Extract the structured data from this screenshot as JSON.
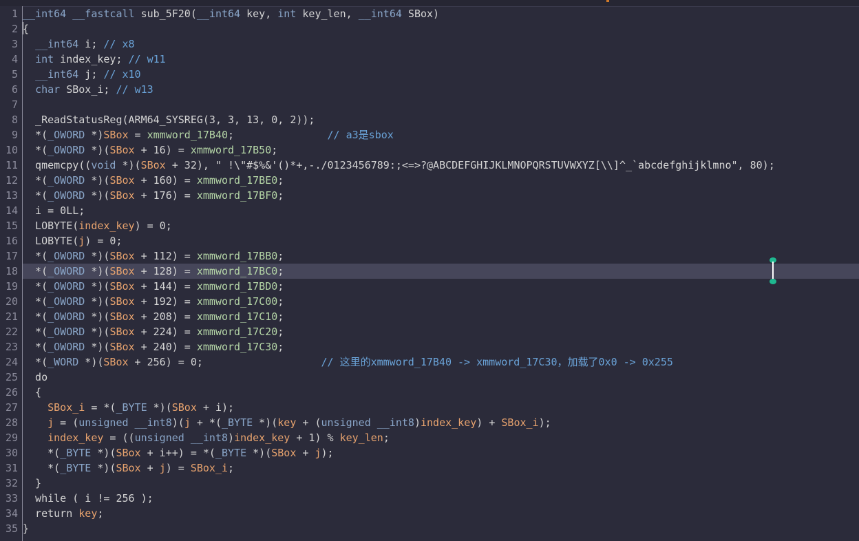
{
  "editor": {
    "function_name": "sub_5F20",
    "highlighted_line": 18,
    "lines": [
      {
        "n": "1",
        "tokens": [
          [
            "type",
            "__int64"
          ],
          [
            "plain",
            " "
          ],
          [
            "type",
            "__fastcall"
          ],
          [
            "plain",
            " sub_5F20("
          ],
          [
            "type",
            "__int64"
          ],
          [
            "plain",
            " key, "
          ],
          [
            "type",
            "int"
          ],
          [
            "plain",
            " key_len, "
          ],
          [
            "type",
            "__int64"
          ],
          [
            "plain",
            " SBox)"
          ]
        ]
      },
      {
        "n": "2",
        "tokens": [
          [
            "plain",
            "{"
          ]
        ]
      },
      {
        "n": "3",
        "tokens": [
          [
            "plain",
            "  "
          ],
          [
            "type",
            "__int64"
          ],
          [
            "plain",
            " i; "
          ],
          [
            "cmt",
            "// x8"
          ]
        ]
      },
      {
        "n": "4",
        "tokens": [
          [
            "plain",
            "  "
          ],
          [
            "type",
            "int"
          ],
          [
            "plain",
            " index_key; "
          ],
          [
            "cmt",
            "// w11"
          ]
        ]
      },
      {
        "n": "5",
        "tokens": [
          [
            "plain",
            "  "
          ],
          [
            "type",
            "__int64"
          ],
          [
            "plain",
            " j; "
          ],
          [
            "cmt",
            "// x10"
          ]
        ]
      },
      {
        "n": "6",
        "tokens": [
          [
            "plain",
            "  "
          ],
          [
            "type",
            "char"
          ],
          [
            "plain",
            " SBox_i; "
          ],
          [
            "cmt",
            "// w13"
          ]
        ]
      },
      {
        "n": "7",
        "tokens": [
          [
            "plain",
            ""
          ]
        ]
      },
      {
        "n": "8",
        "tokens": [
          [
            "plain",
            "  _ReadStatusReg(ARM64_SYSREG(3, 3, 13, 0, 2));"
          ]
        ]
      },
      {
        "n": "9",
        "tokens": [
          [
            "plain",
            "  *("
          ],
          [
            "type",
            "_OWORD"
          ],
          [
            "plain",
            " *)"
          ],
          [
            "var",
            "SBox"
          ],
          [
            "plain",
            " = "
          ],
          [
            "gbl",
            "xmmword_17B40"
          ],
          [
            "plain",
            ";               "
          ],
          [
            "cmt",
            "// a3是sbox"
          ]
        ]
      },
      {
        "n": "10",
        "tokens": [
          [
            "plain",
            "  *("
          ],
          [
            "type",
            "_OWORD"
          ],
          [
            "plain",
            " *)("
          ],
          [
            "var",
            "SBox"
          ],
          [
            "plain",
            " + 16) = "
          ],
          [
            "gbl",
            "xmmword_17B50"
          ],
          [
            "plain",
            ";"
          ]
        ]
      },
      {
        "n": "11",
        "tokens": [
          [
            "plain",
            "  qmemcpy(("
          ],
          [
            "type",
            "void"
          ],
          [
            "plain",
            " *)("
          ],
          [
            "var",
            "SBox"
          ],
          [
            "plain",
            " + 32), \" !\\\"#$%&'()*+,-./0123456789:;<=>?@ABCDEFGHIJKLMNOPQRSTUVWXYZ[\\\\]^_`abcdefghijklmno\", 80);"
          ]
        ]
      },
      {
        "n": "12",
        "tokens": [
          [
            "plain",
            "  *("
          ],
          [
            "type",
            "_OWORD"
          ],
          [
            "plain",
            " *)("
          ],
          [
            "var",
            "SBox"
          ],
          [
            "plain",
            " + 160) = "
          ],
          [
            "gbl",
            "xmmword_17BE0"
          ],
          [
            "plain",
            ";"
          ]
        ]
      },
      {
        "n": "13",
        "tokens": [
          [
            "plain",
            "  *("
          ],
          [
            "type",
            "_OWORD"
          ],
          [
            "plain",
            " *)("
          ],
          [
            "var",
            "SBox"
          ],
          [
            "plain",
            " + 176) = "
          ],
          [
            "gbl",
            "xmmword_17BF0"
          ],
          [
            "plain",
            ";"
          ]
        ]
      },
      {
        "n": "14",
        "tokens": [
          [
            "plain",
            "  i = 0LL;"
          ]
        ]
      },
      {
        "n": "15",
        "tokens": [
          [
            "plain",
            "  LOBYTE("
          ],
          [
            "var",
            "index_key"
          ],
          [
            "plain",
            ") = 0;"
          ]
        ]
      },
      {
        "n": "16",
        "tokens": [
          [
            "plain",
            "  LOBYTE("
          ],
          [
            "var",
            "j"
          ],
          [
            "plain",
            ") = 0;"
          ]
        ]
      },
      {
        "n": "17",
        "tokens": [
          [
            "plain",
            "  *("
          ],
          [
            "type",
            "_OWORD"
          ],
          [
            "plain",
            " *)("
          ],
          [
            "var",
            "SBox"
          ],
          [
            "plain",
            " + 112) = "
          ],
          [
            "gbl",
            "xmmword_17BB0"
          ],
          [
            "plain",
            ";"
          ]
        ]
      },
      {
        "n": "18",
        "tokens": [
          [
            "plain",
            "  *("
          ],
          [
            "type",
            "_OWORD"
          ],
          [
            "plain",
            " *)("
          ],
          [
            "var",
            "SBox"
          ],
          [
            "plain",
            " + 128) = "
          ],
          [
            "gbl",
            "xmmword_17BC0"
          ],
          [
            "plain",
            ";"
          ]
        ]
      },
      {
        "n": "19",
        "tokens": [
          [
            "plain",
            "  *("
          ],
          [
            "type",
            "_OWORD"
          ],
          [
            "plain",
            " *)("
          ],
          [
            "var",
            "SBox"
          ],
          [
            "plain",
            " + 144) = "
          ],
          [
            "gbl",
            "xmmword_17BD0"
          ],
          [
            "plain",
            ";"
          ]
        ]
      },
      {
        "n": "20",
        "tokens": [
          [
            "plain",
            "  *("
          ],
          [
            "type",
            "_OWORD"
          ],
          [
            "plain",
            " *)("
          ],
          [
            "var",
            "SBox"
          ],
          [
            "plain",
            " + 192) = "
          ],
          [
            "gbl",
            "xmmword_17C00"
          ],
          [
            "plain",
            ";"
          ]
        ]
      },
      {
        "n": "21",
        "tokens": [
          [
            "plain",
            "  *("
          ],
          [
            "type",
            "_OWORD"
          ],
          [
            "plain",
            " *)("
          ],
          [
            "var",
            "SBox"
          ],
          [
            "plain",
            " + 208) = "
          ],
          [
            "gbl",
            "xmmword_17C10"
          ],
          [
            "plain",
            ";"
          ]
        ]
      },
      {
        "n": "22",
        "tokens": [
          [
            "plain",
            "  *("
          ],
          [
            "type",
            "_OWORD"
          ],
          [
            "plain",
            " *)("
          ],
          [
            "var",
            "SBox"
          ],
          [
            "plain",
            " + 224) = "
          ],
          [
            "gbl",
            "xmmword_17C20"
          ],
          [
            "plain",
            ";"
          ]
        ]
      },
      {
        "n": "23",
        "tokens": [
          [
            "plain",
            "  *("
          ],
          [
            "type",
            "_OWORD"
          ],
          [
            "plain",
            " *)("
          ],
          [
            "var",
            "SBox"
          ],
          [
            "plain",
            " + 240) = "
          ],
          [
            "gbl",
            "xmmword_17C30"
          ],
          [
            "plain",
            ";"
          ]
        ]
      },
      {
        "n": "24",
        "tokens": [
          [
            "plain",
            "  *("
          ],
          [
            "type",
            "_WORD"
          ],
          [
            "plain",
            " *)("
          ],
          [
            "var",
            "SBox"
          ],
          [
            "plain",
            " + 256) = 0;                   "
          ],
          [
            "cmt",
            "// 这里的xmmword_17B40 -> xmmword_17C30，加载了0x0 -> 0x255"
          ]
        ]
      },
      {
        "n": "25",
        "tokens": [
          [
            "plain",
            "  do"
          ]
        ]
      },
      {
        "n": "26",
        "tokens": [
          [
            "plain",
            "  {"
          ]
        ]
      },
      {
        "n": "27",
        "tokens": [
          [
            "plain",
            "    "
          ],
          [
            "var",
            "SBox_i"
          ],
          [
            "plain",
            " = *("
          ],
          [
            "type",
            "_BYTE"
          ],
          [
            "plain",
            " *)("
          ],
          [
            "var",
            "SBox"
          ],
          [
            "plain",
            " + i);"
          ]
        ]
      },
      {
        "n": "28",
        "tokens": [
          [
            "plain",
            "    "
          ],
          [
            "var",
            "j"
          ],
          [
            "plain",
            " = ("
          ],
          [
            "type",
            "unsigned __int8"
          ],
          [
            "plain",
            ")("
          ],
          [
            "var",
            "j"
          ],
          [
            "plain",
            " + *("
          ],
          [
            "type",
            "_BYTE"
          ],
          [
            "plain",
            " *)("
          ],
          [
            "var",
            "key"
          ],
          [
            "plain",
            " + ("
          ],
          [
            "type",
            "unsigned __int8"
          ],
          [
            "plain",
            ")"
          ],
          [
            "var",
            "index_key"
          ],
          [
            "plain",
            ") + "
          ],
          [
            "var",
            "SBox_i"
          ],
          [
            "plain",
            ");"
          ]
        ]
      },
      {
        "n": "29",
        "tokens": [
          [
            "plain",
            "    "
          ],
          [
            "var",
            "index_key"
          ],
          [
            "plain",
            " = (("
          ],
          [
            "type",
            "unsigned __int8"
          ],
          [
            "plain",
            ")"
          ],
          [
            "var",
            "index_key"
          ],
          [
            "plain",
            " + 1) % "
          ],
          [
            "var",
            "key_len"
          ],
          [
            "plain",
            ";"
          ]
        ]
      },
      {
        "n": "30",
        "tokens": [
          [
            "plain",
            "    *("
          ],
          [
            "type",
            "_BYTE"
          ],
          [
            "plain",
            " *)("
          ],
          [
            "var",
            "SBox"
          ],
          [
            "plain",
            " + i++) = *("
          ],
          [
            "type",
            "_BYTE"
          ],
          [
            "plain",
            " *)("
          ],
          [
            "var",
            "SBox"
          ],
          [
            "plain",
            " + "
          ],
          [
            "var",
            "j"
          ],
          [
            "plain",
            ");"
          ]
        ]
      },
      {
        "n": "31",
        "tokens": [
          [
            "plain",
            "    *("
          ],
          [
            "type",
            "_BYTE"
          ],
          [
            "plain",
            " *)("
          ],
          [
            "var",
            "SBox"
          ],
          [
            "plain",
            " + "
          ],
          [
            "var",
            "j"
          ],
          [
            "plain",
            ") = "
          ],
          [
            "var",
            "SBox_i"
          ],
          [
            "plain",
            ";"
          ]
        ]
      },
      {
        "n": "32",
        "tokens": [
          [
            "plain",
            "  }"
          ]
        ]
      },
      {
        "n": "33",
        "tokens": [
          [
            "plain",
            "  while ( i != 256 );"
          ]
        ]
      },
      {
        "n": "34",
        "tokens": [
          [
            "plain",
            "  return "
          ],
          [
            "var",
            "key"
          ],
          [
            "plain",
            ";"
          ]
        ]
      },
      {
        "n": "35",
        "tokens": [
          [
            "plain",
            "}"
          ]
        ]
      }
    ]
  }
}
